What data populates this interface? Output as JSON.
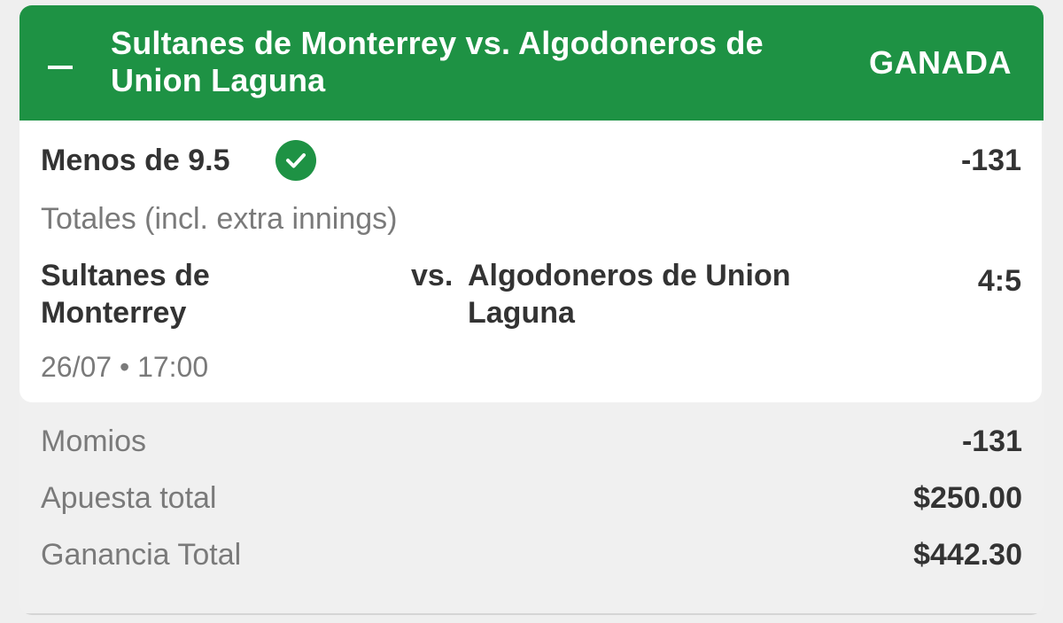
{
  "header": {
    "match_title": "Sultanes de Monterrey vs. Algodoneros de Union Laguna",
    "result": "GANADA",
    "collapse_icon": "minus-icon",
    "background_color": "#1e9244"
  },
  "selection": {
    "name": "Menos de 9.5",
    "status_icon": "check-circle-icon",
    "odds": "-131",
    "market": "Totales (incl. extra innings)",
    "home_team": "Sultanes de Monterrey",
    "vs_label": "vs.",
    "away_team": "Algodoneros de Union Laguna",
    "score": "4:5",
    "date_time": "26/07 • 17:00"
  },
  "summary": [
    {
      "label": "Momios",
      "value": "-131"
    },
    {
      "label": "Apuesta total",
      "value": "$250.00"
    },
    {
      "label": "Ganancia Total",
      "value": "$442.30"
    }
  ]
}
